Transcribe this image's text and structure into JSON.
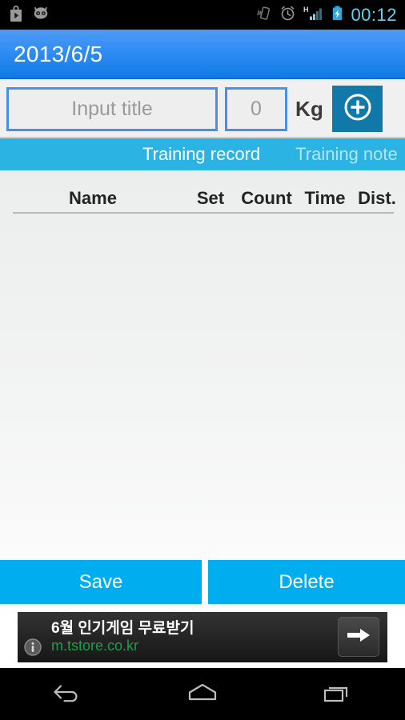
{
  "statusbar": {
    "clock": "00:12",
    "left_icons": [
      "play-store-icon",
      "cyanogenmod-icon"
    ],
    "right_icons": [
      "vibrate-icon",
      "alarm-icon",
      "signal-h-icon",
      "battery-charging-icon"
    ],
    "network_type": "H",
    "background": "#000000",
    "clock_color": "#61d2f2"
  },
  "titlebar": {
    "date": "2013/6/5",
    "background": "#2f8cf3",
    "text_color": "#ffffff"
  },
  "input_row": {
    "title_placeholder": "Input title",
    "title_value": "",
    "weight_placeholder": "0",
    "weight_value": "",
    "unit_label": "Kg",
    "add_button_icon": "plus-circle-icon",
    "add_button_color": "#1179a9",
    "field_border_color": "#4a90e2"
  },
  "tabs": {
    "background": "#2bb3e4",
    "items": [
      {
        "label": "Training record",
        "active": true
      },
      {
        "label": "Training note",
        "active": false
      }
    ]
  },
  "list": {
    "columns": [
      "Name",
      "Set",
      "Count",
      "Time",
      "Dist."
    ],
    "rows": []
  },
  "actions": {
    "save_label": "Save",
    "delete_label": "Delete",
    "button_color": "#00aeef"
  },
  "ad": {
    "title": "6월 인기게임 무료받기",
    "url": "m.tstore.co.kr",
    "info_icon": "info-circle-icon",
    "arrow_icon": "arrow-right-icon",
    "url_color": "#1f9d4d"
  },
  "navbar": {
    "buttons": [
      "back-icon",
      "home-icon",
      "recents-icon"
    ]
  }
}
